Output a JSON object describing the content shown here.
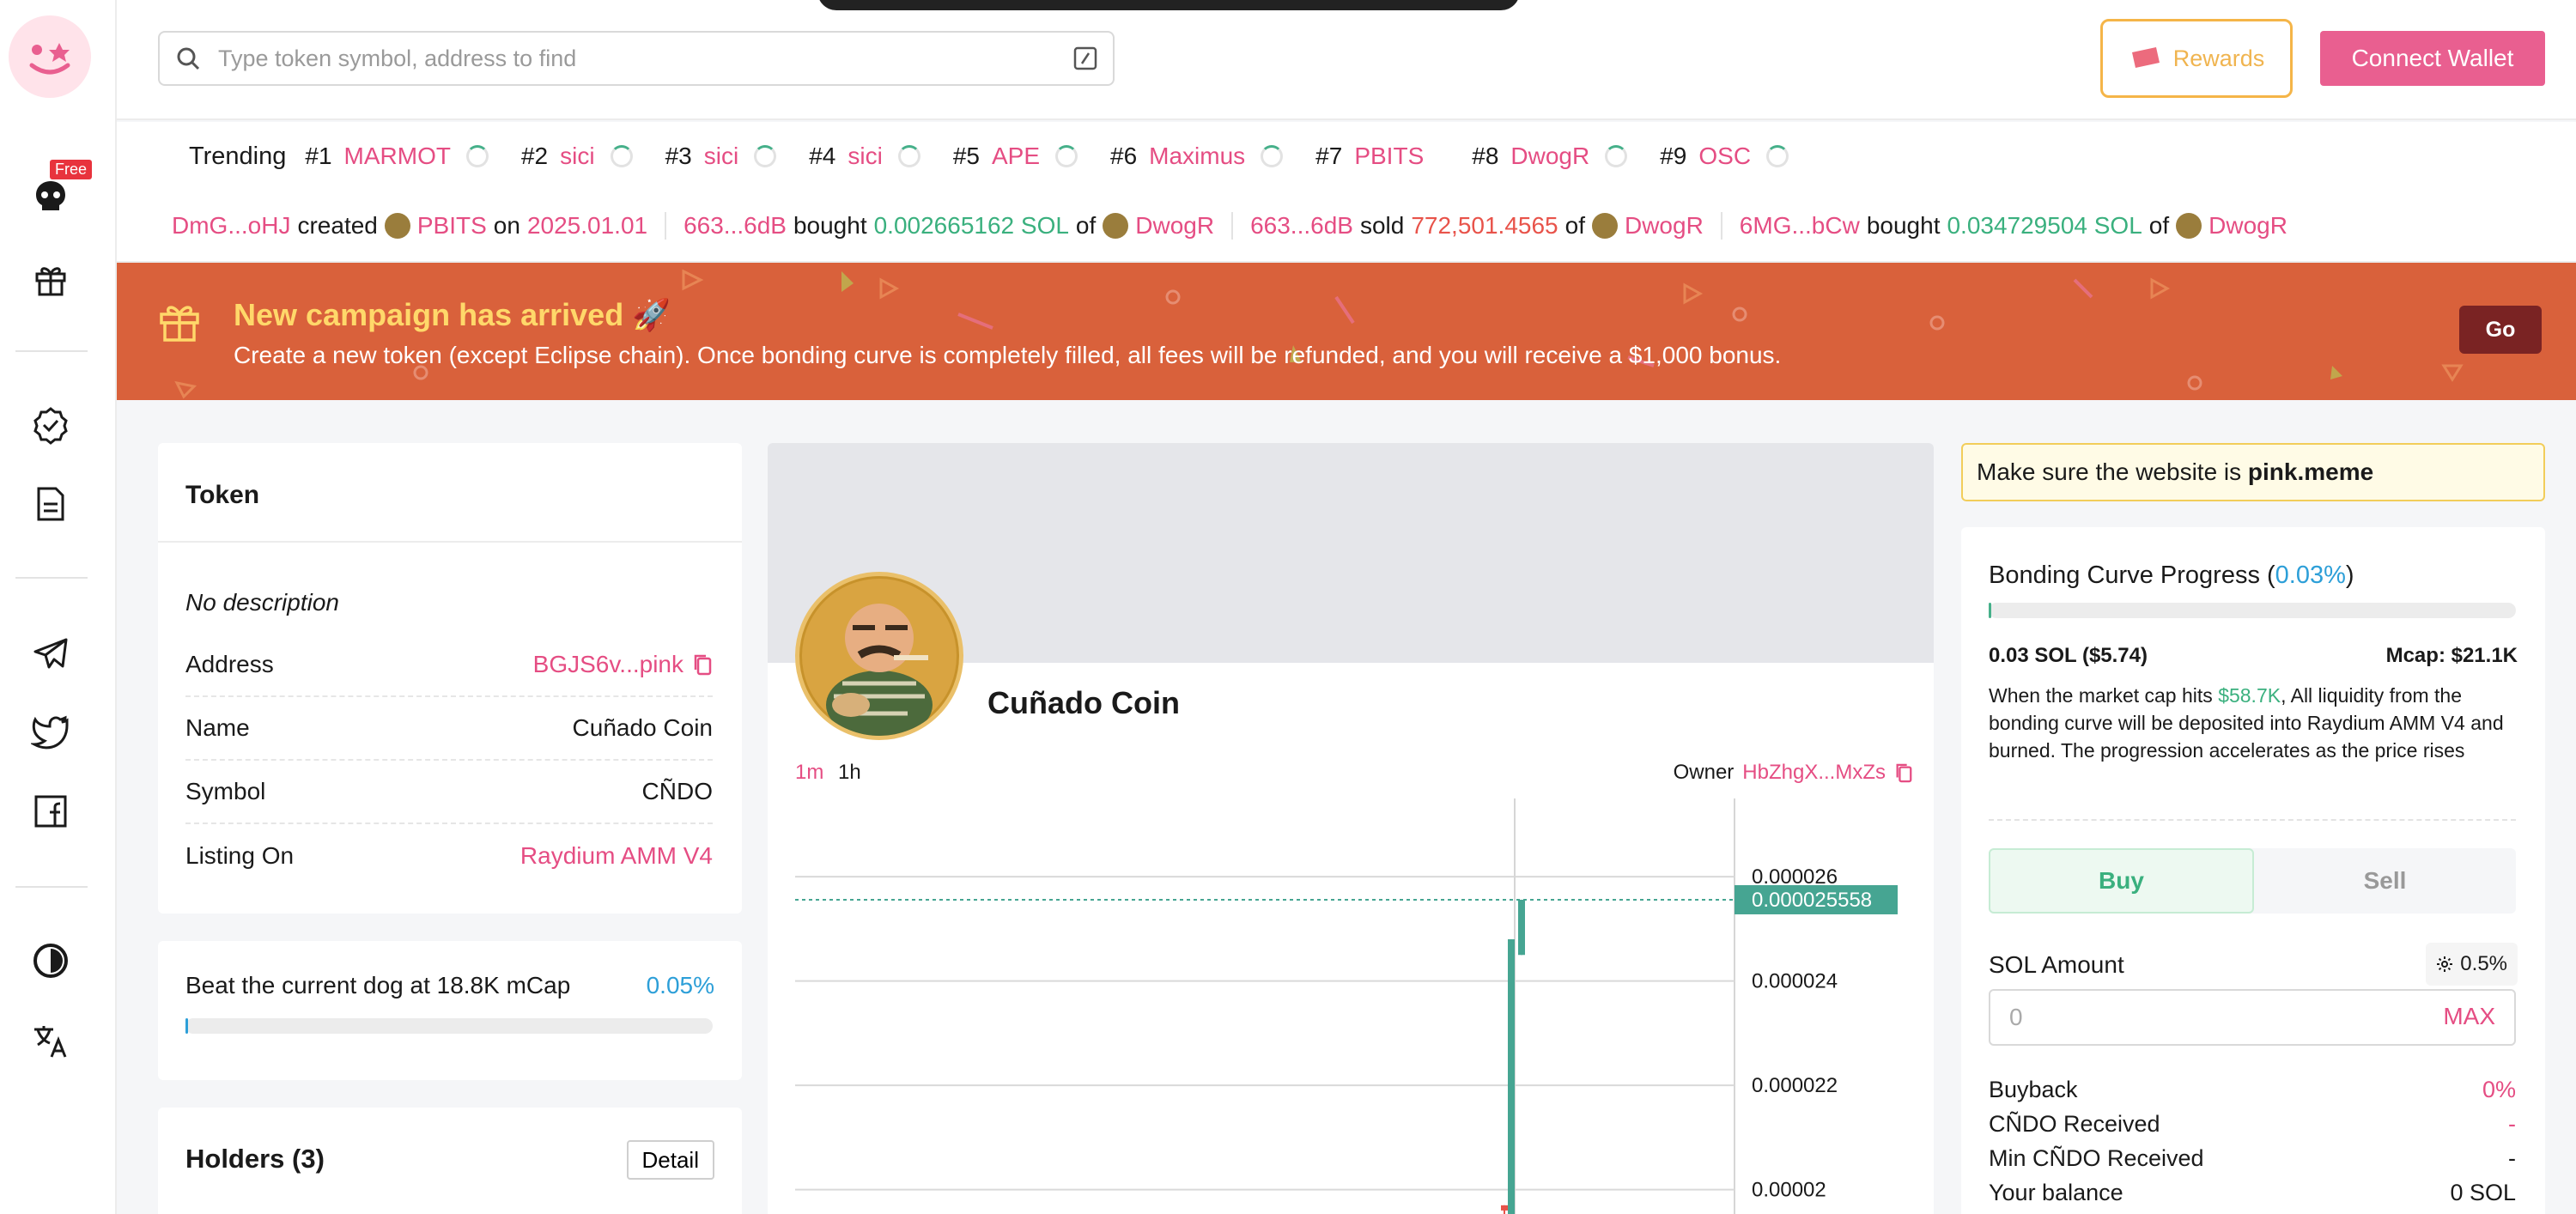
{
  "search": {
    "placeholder": "Type token symbol, address to find"
  },
  "header": {
    "rewards_label": "Rewards",
    "connect_label": "Connect Wallet"
  },
  "sidebar": {
    "free_badge": "Free"
  },
  "trending": {
    "label": "Trending",
    "items": [
      {
        "rank": "#1",
        "symbol": "MARMOT"
      },
      {
        "rank": "#2",
        "symbol": "sici"
      },
      {
        "rank": "#3",
        "symbol": "sici"
      },
      {
        "rank": "#4",
        "symbol": "sici"
      },
      {
        "rank": "#5",
        "symbol": "APE"
      },
      {
        "rank": "#6",
        "symbol": "Maximus"
      },
      {
        "rank": "#7",
        "symbol": "PBITS"
      },
      {
        "rank": "#8",
        "symbol": "DwogR"
      },
      {
        "rank": "#9",
        "symbol": "OSC"
      }
    ]
  },
  "activity": [
    {
      "user": "DmG...oHJ",
      "action": "created",
      "token": "PBITS",
      "mid": "on",
      "date": "2025.01.01"
    },
    {
      "user": "663...6dB",
      "action": "bought",
      "amount": "0.002665162 SOL",
      "of": "of",
      "token": "DwogR"
    },
    {
      "user": "663...6dB",
      "action": "sold",
      "amount": "772,501.4565",
      "of": "of",
      "token": "DwogR"
    },
    {
      "user": "6MG...bCw",
      "action": "bought",
      "amount": "0.034729504 SOL",
      "of": "of",
      "token": "DwogR"
    }
  ],
  "banner": {
    "title": "New campaign has arrived 🚀",
    "text": "Create a new token (except Eclipse chain). Once bonding curve is completely filled, all fees will be refunded, and you will receive a $1,000 bonus.",
    "go_label": "Go"
  },
  "token": {
    "title": "Token",
    "description": "No description",
    "rows": [
      {
        "label": "Address",
        "value": "BGJS6v...pink"
      },
      {
        "label": "Name",
        "value": "Cuñado Coin"
      },
      {
        "label": "Symbol",
        "value": "CÑDO"
      },
      {
        "label": "Listing On",
        "value": "Raydium AMM V4"
      }
    ]
  },
  "beat": {
    "label": "Beat the current dog at 18.8K mCap",
    "value": "0.05%",
    "progress": 0.05
  },
  "holders": {
    "title": "Holders (3)",
    "detail_label": "Detail"
  },
  "coin": {
    "name": "Cuñado Coin",
    "timeframes": [
      "1m",
      "1h"
    ],
    "owner_label": "Owner",
    "owner_value": "HbZhgX...MxZs"
  },
  "chart_data": {
    "type": "candlestick",
    "y_ticks": [
      "0.000026",
      "0.000024",
      "0.000022",
      "0.00002"
    ],
    "y_tick_values": [
      2.6e-05,
      2.4e-05,
      2.2e-05,
      2e-05
    ],
    "ylim": [
      1.95e-05,
      2.75e-05
    ],
    "last_price_label": "0.000025558",
    "last_price": 2.5558e-05,
    "candles": [
      {
        "open": 1.97e-05,
        "close": 1.96e-05,
        "high": 1.97e-05,
        "low": 1.94e-05,
        "color": "red"
      },
      {
        "open": 1.95e-05,
        "close": 2.48e-05,
        "high": 2.48e-05,
        "low": 1.95e-05,
        "color": "green"
      },
      {
        "open": 2.45e-05,
        "close": 2.5558e-05,
        "high": 2.5558e-05,
        "low": 2.45e-05,
        "color": "green"
      }
    ]
  },
  "website_warning": {
    "prefix": "Make sure the website is",
    "domain": "pink.meme"
  },
  "bonding": {
    "title_prefix": "Bonding Curve Progress (",
    "percent": "0.03%",
    "title_suffix": ")",
    "progress": 0.03,
    "sol": "0.03 SOL ($5.74)",
    "mcap": "Mcap: $21.1K",
    "desc_prefix": "When the market cap hits",
    "desc_target": "$58.7K",
    "desc_suffix": ", All liquidity from the bonding curve will be deposited into Raydium AMM V4 and burned. The progression accelerates as the price rises"
  },
  "trade": {
    "buy_label": "Buy",
    "sell_label": "Sell",
    "sol_amount_label": "SOL Amount",
    "slippage": "0.5%",
    "amount_placeholder": "0",
    "max_label": "MAX",
    "rows": [
      {
        "label": "Buyback",
        "value": "0%"
      },
      {
        "label": "CÑDO Received",
        "value": "-"
      },
      {
        "label": "Min CÑDO Received",
        "value": "-"
      },
      {
        "label": "Your balance",
        "value": "0 SOL"
      }
    ]
  },
  "colors": {
    "accent": "#e95f90",
    "green": "#3ab07e",
    "red": "#e8534a",
    "banner": "#d9613b"
  }
}
